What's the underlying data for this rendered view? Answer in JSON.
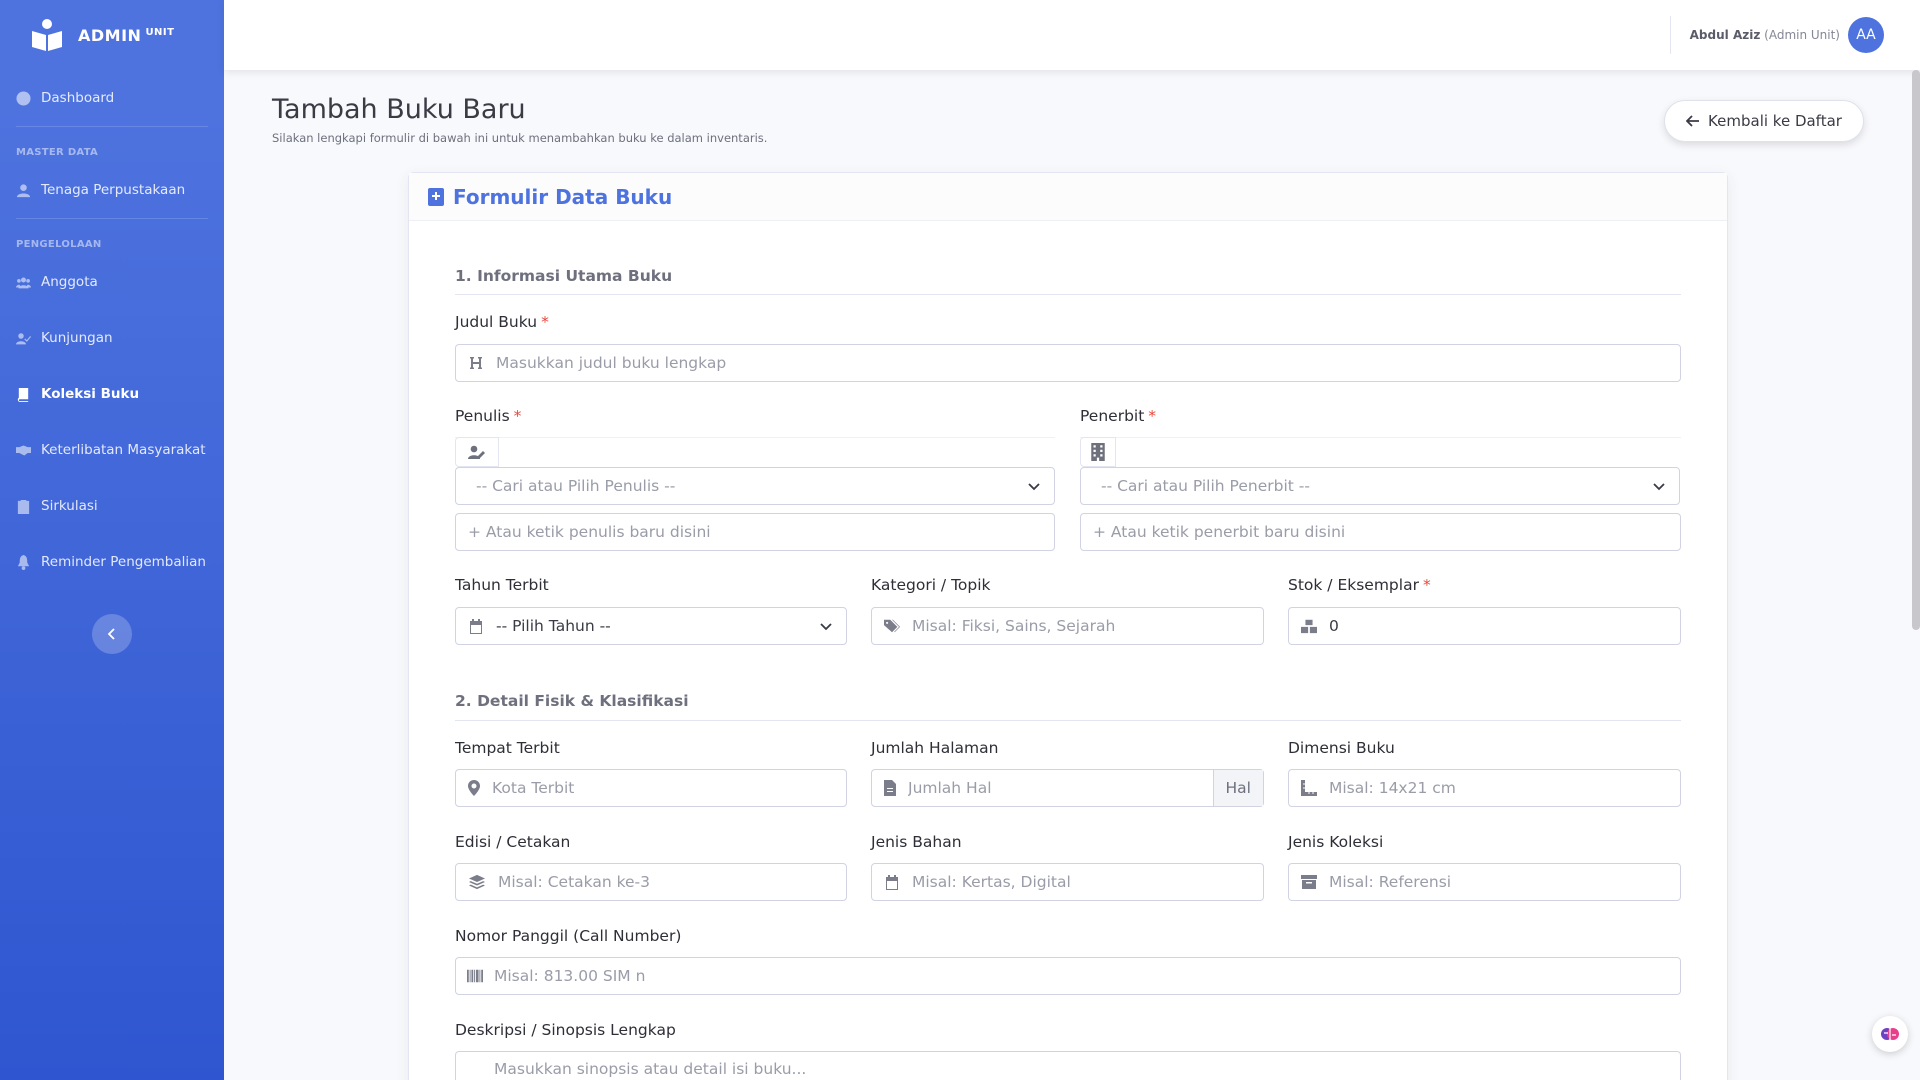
{
  "brand": {
    "name": "ADMIN",
    "suffix": "UNIT"
  },
  "sidebar": {
    "items": [
      {
        "label": "Dashboard"
      },
      {
        "heading": "MASTER DATA"
      },
      {
        "label": "Tenaga Perpustakaan"
      },
      {
        "heading": "PENGELOLAAN"
      },
      {
        "label": "Anggota"
      },
      {
        "label": "Kunjungan"
      },
      {
        "label": "Koleksi Buku",
        "active": true
      },
      {
        "label": "Keterlibatan Masyarakat"
      },
      {
        "label": "Sirkulasi"
      },
      {
        "label": "Reminder Pengembalian"
      }
    ]
  },
  "topbar": {
    "user_name": "Abdul Aziz",
    "user_role": "(Admin Unit)",
    "avatar_initials": "AA"
  },
  "page": {
    "title": "Tambah Buku Baru",
    "subtitle": "Silakan lengkapi formulir di bawah ini untuk menambahkan buku ke dalam inventaris.",
    "back_label": "Kembali ke Daftar"
  },
  "form": {
    "title": "Formulir Data Buku",
    "section1": "1. Informasi Utama Buku",
    "section2": "2. Detail Fisik & Klasifikasi",
    "required_mark": "*",
    "judul": {
      "label": "Judul Buku",
      "placeholder": "Masukkan judul buku lengkap"
    },
    "penulis": {
      "label": "Penulis",
      "select": "-- Cari atau Pilih Penulis --",
      "new_placeholder": "+ Atau ketik penulis baru disini"
    },
    "penerbit": {
      "label": "Penerbit",
      "select": "-- Cari atau Pilih Penerbit --",
      "new_placeholder": "+ Atau ketik penerbit baru disini"
    },
    "tahun": {
      "label": "Tahun Terbit",
      "select": "-- Pilih Tahun --"
    },
    "kategori": {
      "label": "Kategori / Topik",
      "placeholder": "Misal: Fiksi, Sains, Sejarah"
    },
    "stok": {
      "label": "Stok / Eksemplar",
      "value": "0"
    },
    "tempat": {
      "label": "Tempat Terbit",
      "placeholder": "Kota Terbit"
    },
    "halaman": {
      "label": "Jumlah Halaman",
      "placeholder": "Jumlah Hal",
      "addon": "Hal"
    },
    "dimensi": {
      "label": "Dimensi Buku",
      "placeholder": "Misal: 14x21 cm"
    },
    "edisi": {
      "label": "Edisi / Cetakan",
      "placeholder": "Misal: Cetakan ke-3"
    },
    "bahan": {
      "label": "Jenis Bahan",
      "placeholder": "Misal: Kertas, Digital"
    },
    "koleksi": {
      "label": "Jenis Koleksi",
      "placeholder": "Misal: Referensi"
    },
    "call_number": {
      "label": "Nomor Panggil (Call Number)",
      "placeholder": "Misal: 813.00 SIM n"
    },
    "deskripsi": {
      "label": "Deskripsi / Sinopsis Lengkap",
      "placeholder": "Masukkan sinopsis atau detail isi buku..."
    }
  },
  "colors": {
    "primary": "#4e73df",
    "danger": "#e74a3b"
  }
}
